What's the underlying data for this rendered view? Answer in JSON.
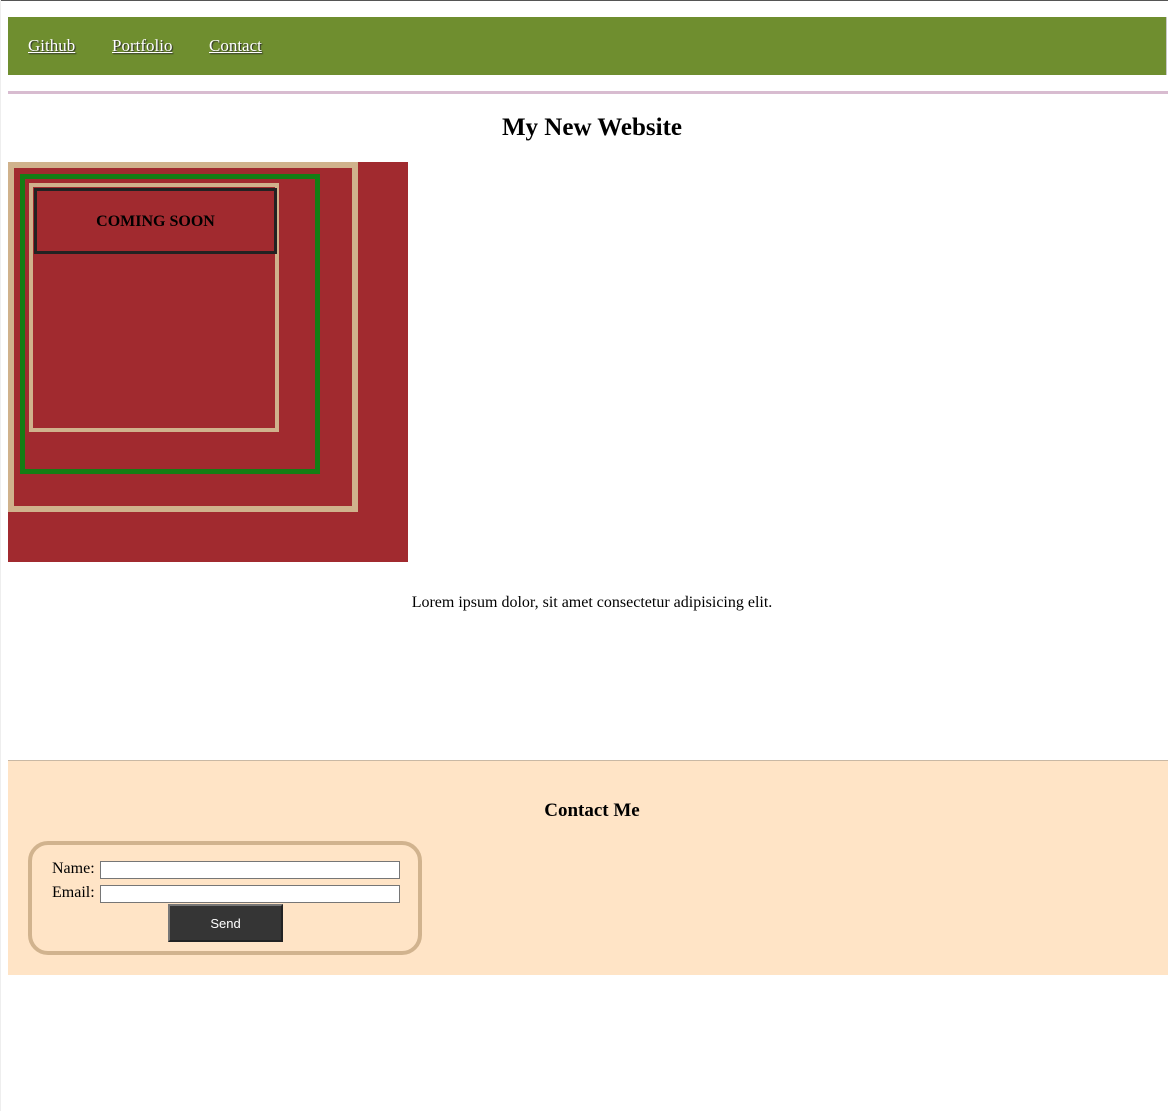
{
  "nav": {
    "links": [
      {
        "label": "Github"
      },
      {
        "label": "Portfolio"
      },
      {
        "label": "Contact"
      }
    ]
  },
  "main": {
    "title": "My New Website",
    "banner_text": "COMING SOON",
    "paragraph": "Lorem ipsum dolor, sit amet consectetur adipisicing elit."
  },
  "footer": {
    "title": "Contact Me",
    "form": {
      "name_label": "Name:",
      "name_value": "",
      "email_label": "Email:",
      "email_value": "",
      "send_label": "Send"
    }
  },
  "colors": {
    "nav_background": "#6f8e2f",
    "banner_background": "#a12a2f",
    "tan_border": "#d0b28c",
    "green_border": "#157d14",
    "footer_background": "#ffe4c6",
    "button_background": "#353535",
    "divider": "#d8bcd0"
  }
}
